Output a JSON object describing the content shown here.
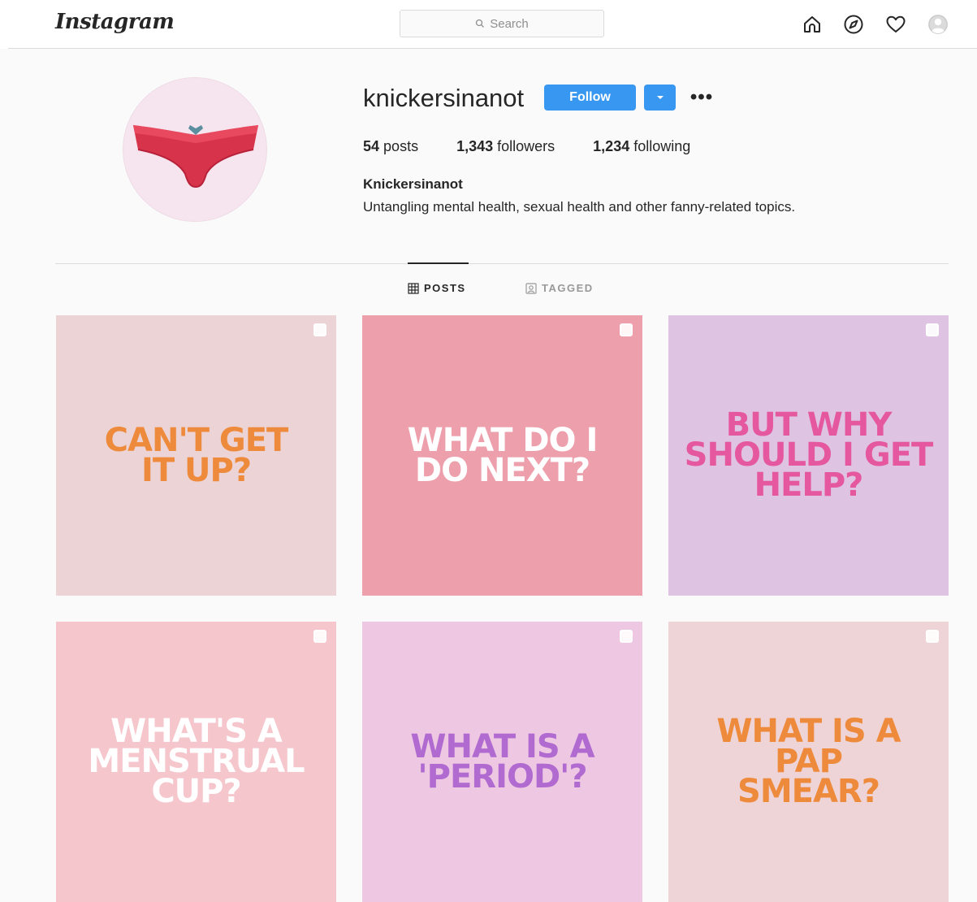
{
  "app": {
    "logo": "Instagram"
  },
  "search": {
    "placeholder": "Search"
  },
  "nav": {
    "icons": [
      "home-icon",
      "explore-icon",
      "heart-icon",
      "profile-avatar"
    ]
  },
  "profile": {
    "username": "knickersinanot",
    "follow_label": "Follow",
    "more_label": "•••",
    "stats": [
      {
        "count": "54",
        "label": "posts"
      },
      {
        "count": "1,343",
        "label": "followers"
      },
      {
        "count": "1,234",
        "label": "following"
      }
    ],
    "full_name": "Knickersinanot",
    "bio": "Untangling mental health, sexual health and other fanny-related topics."
  },
  "tabs": [
    {
      "label": "POSTS",
      "active": true
    },
    {
      "label": "TAGGED",
      "active": false
    }
  ],
  "posts": [
    {
      "text": "CAN'T GET\nIT UP?",
      "bg": "#ecd3d6",
      "fg": "#ee8a3b"
    },
    {
      "text": "WHAT DO I\nDO NEXT?",
      "bg": "#ee9fac",
      "fg": "#ffffff"
    },
    {
      "text": "BUT WHY\nSHOULD I GET\nHELP?",
      "bg": "#dec3e3",
      "fg": "#e5579f"
    },
    {
      "text": "WHAT'S A\nMENSTRUAL\nCUP?",
      "bg": "#f6c6cd",
      "fg": "#ffffff"
    },
    {
      "text": "WHAT IS A\n'PERIOD'?",
      "bg": "#eec8e2",
      "fg": "#b06ad0"
    },
    {
      "text": "WHAT IS A\nPAP\nSMEAR?",
      "bg": "#eed4d6",
      "fg": "#ee8a3b"
    }
  ]
}
